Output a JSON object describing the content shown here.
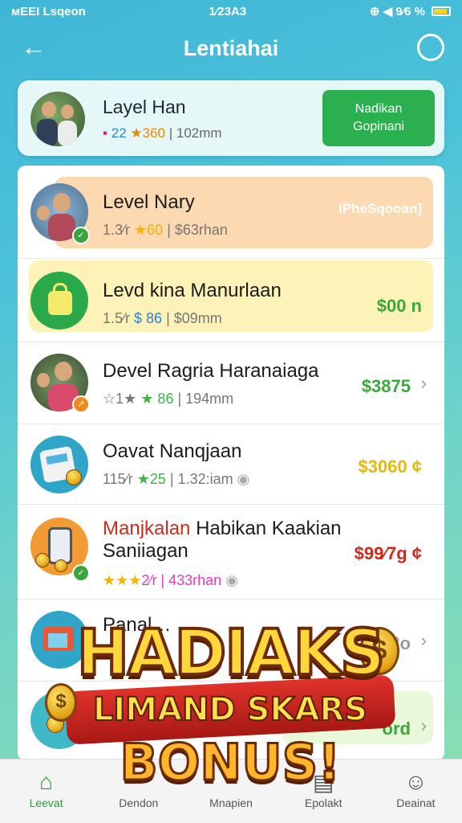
{
  "status": {
    "left": "ᴍEEI Lsqeon",
    "time": "1⁄23A3",
    "right": "⊕ ◀ 9⁄6 %"
  },
  "header": {
    "title": "Lentiahai",
    "back_icon": "arrow-left-icon",
    "chat_icon": "chat-bubble-icon"
  },
  "user": {
    "name": "Layel Han",
    "meta": {
      "a": "▪ ",
      "b": "22 ",
      "c": "★360",
      "d": " | 102mm"
    },
    "cta_line1": "Nadikan",
    "cta_line2": "Gopinani"
  },
  "rows": [
    {
      "name": "Level Nary",
      "meta_pre": "1.3⁄r ",
      "meta_star": "★60",
      "meta_post": " | $63rhan",
      "price": "IPheSqooan]",
      "bg": "#fcd9b0",
      "price_color": "#ffffff"
    },
    {
      "name": "Levd kina Manurlaan",
      "meta_pre": "1.5⁄r ",
      "meta_star": "$ 86",
      "meta_post": " | $09mm",
      "price": "$00 n",
      "bg": "#fdf3b8",
      "price_color": "#3aa83a"
    },
    {
      "name": "Devel Ragria Haranaiaga",
      "meta_pre": "☆1★ ",
      "meta_star": "★ 86",
      "meta_post": " | 194mm",
      "price": "$3875",
      "bg": "",
      "price_color": "#3aa83a"
    },
    {
      "name": "Oavat Nanqjaan",
      "meta_pre": "115⁄r ",
      "meta_star": "★25",
      "meta_post": " | 1.32:iam",
      "price": "$3060 ¢",
      "bg": "",
      "price_color": "#e2ba12"
    },
    {
      "name_red": "Manjkalan",
      "name": " Habikan Kaakian",
      "name2": "Saniiagan",
      "meta_pre": "",
      "meta_star": "★★★",
      "meta_post": "2⁄r | 433rhan",
      "price": "$99⁄7g ¢",
      "bg": "",
      "price_color": "#d02a1c"
    },
    {
      "name": "Panal…",
      "price": "°o",
      "bg": "",
      "price_color": "#999999"
    },
    {
      "name": "",
      "price": "ord",
      "bg": "#e8f8d8",
      "price_color": "#3aa83a"
    }
  ],
  "promo": {
    "line1": "HADIAKS",
    "line2": "LIMAND SKARS",
    "line3": "BONUS!"
  },
  "nav": [
    {
      "label": "Leevat",
      "icon": "house-icon",
      "active": true
    },
    {
      "label": "Dendon",
      "icon": "",
      "active": false
    },
    {
      "label": "Mnapien",
      "icon": "",
      "active": false
    },
    {
      "label": "Epolakt",
      "icon": "box-icon",
      "active": false
    },
    {
      "label": "Deainat",
      "icon": "user-icon",
      "active": false
    }
  ]
}
